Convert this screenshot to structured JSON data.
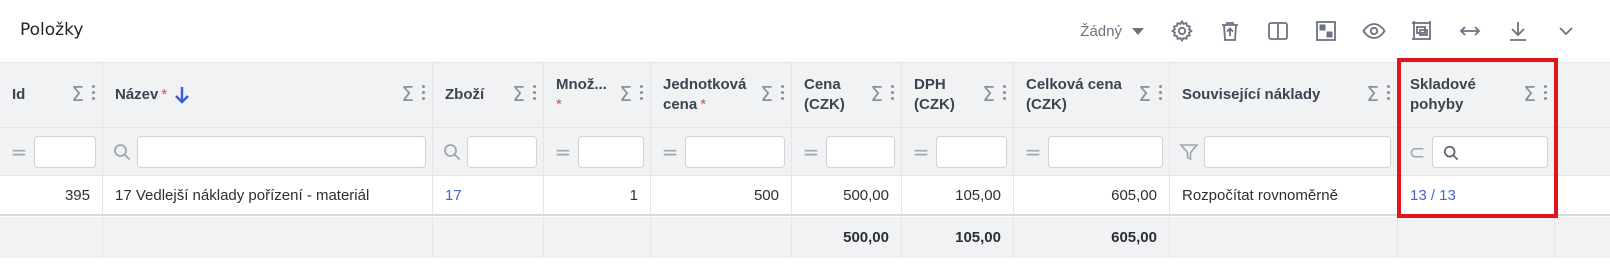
{
  "panel": {
    "title": "Položky",
    "preset_label": "Žádný"
  },
  "toolbar_icons": [
    "gear-icon",
    "trash-icon",
    "columns-icon",
    "layout-icon",
    "eye-icon",
    "fullscreen-icon",
    "width-icon",
    "download-icon",
    "chevron-down-icon"
  ],
  "columns": [
    {
      "label": "Id",
      "required": false,
      "filter_op": "="
    },
    {
      "label": "Název",
      "required": true,
      "sorted": "desc",
      "filter_op": "search"
    },
    {
      "label": "Zboží",
      "required": false,
      "filter_op": "search"
    },
    {
      "label": "Množ...",
      "required": true,
      "filter_op": "="
    },
    {
      "label": "Jednotková cena",
      "required": true,
      "filter_op": "="
    },
    {
      "label": "Cena (CZK)",
      "required": false,
      "filter_op": "="
    },
    {
      "label": "DPH (CZK)",
      "required": false,
      "filter_op": "="
    },
    {
      "label": "Celková cena (CZK)",
      "required": false,
      "filter_op": "="
    },
    {
      "label": "Související náklady",
      "required": false,
      "filter_op": "filter"
    },
    {
      "label": "Skladové pohyby",
      "required": false,
      "filter_op": "⊂"
    }
  ],
  "row": {
    "id": "395",
    "nazev": "17 Vedlejší náklady pořízení - materiál",
    "zbozi": "17",
    "mnozstvi": "1",
    "jednotkova_cena": "500",
    "cena": "500,00",
    "dph": "105,00",
    "celkova_cena": "605,00",
    "souvisejici_naklady": "Rozpočítat rovnoměrně",
    "skladove_pohyby": "13 / 13"
  },
  "totals": {
    "cena": "500,00",
    "dph": "105,00",
    "celkova_cena": "605,00"
  },
  "colors": {
    "highlight": "#e0161d",
    "link": "#4a63d4",
    "required": "#e5484d",
    "sort_arrow": "#3b5bdb"
  }
}
